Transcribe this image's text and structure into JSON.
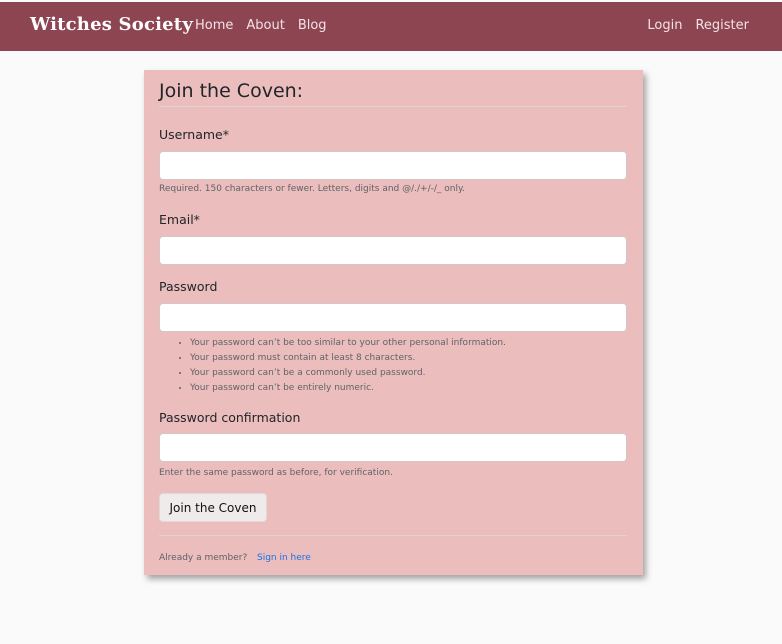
{
  "nav": {
    "brand": "Witches Society",
    "left_links": [
      "Home",
      "About",
      "Blog"
    ],
    "right_links": [
      "Login",
      "Register"
    ]
  },
  "form": {
    "title": "Join the Coven:",
    "username_label": "Username*",
    "username_value": "",
    "username_help": "Required. 150 characters or fewer. Letters, digits and @/./+/-/_ only.",
    "email_label": "Email*",
    "email_value": "",
    "password_label": "Password",
    "password_value": "",
    "password_help": [
      "Your password can’t be too similar to your other personal information.",
      "Your password must contain at least 8 characters.",
      "Your password can’t be a commonly used password.",
      "Your password can’t be entirely numeric."
    ],
    "password2_label": "Password confirmation",
    "password2_value": "",
    "password2_help": "Enter the same password as before, for verification.",
    "submit_label": "Join the Coven",
    "footer_text": "Already a member?",
    "footer_link": "Sign in here"
  },
  "colors": {
    "navbar": "#8e4552",
    "card": "#ebbdbd",
    "page_background": "#fafafa",
    "link": "#1a73e8"
  }
}
